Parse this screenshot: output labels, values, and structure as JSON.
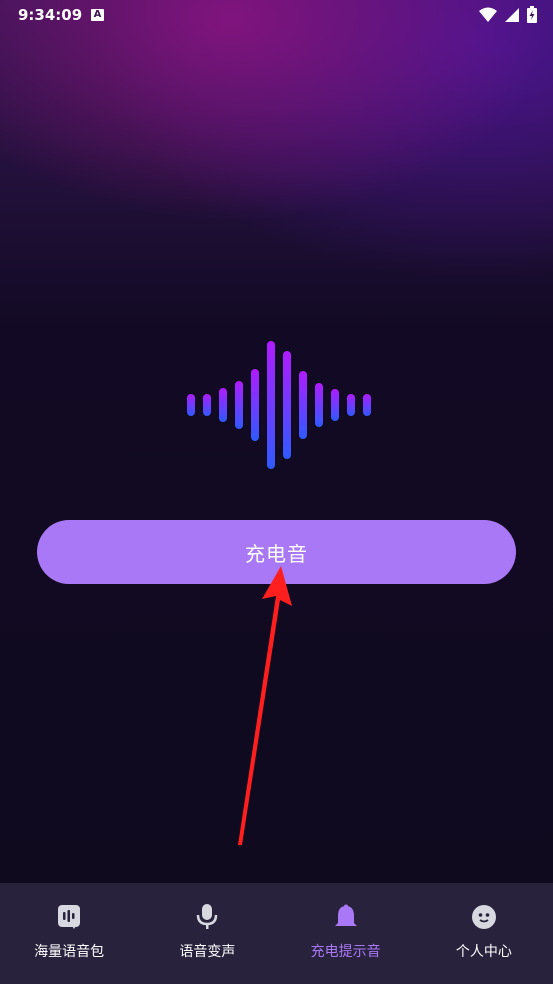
{
  "status_bar": {
    "time": "9:34:09",
    "notification_letter": "A"
  },
  "main": {
    "button_label": "充电音"
  },
  "tabbar": {
    "tabs": [
      {
        "label": "海量语音包",
        "icon": "voice-pack-icon"
      },
      {
        "label": "语音变声",
        "icon": "microphone-icon"
      },
      {
        "label": "充电提示音",
        "icon": "bell-icon"
      },
      {
        "label": "个人中心",
        "icon": "smiley-face-icon"
      }
    ],
    "active_index": 2
  },
  "colors": {
    "accent": "#a978f7",
    "tabbar_bg": "#28223d",
    "arrow": "#ff1f1f"
  }
}
